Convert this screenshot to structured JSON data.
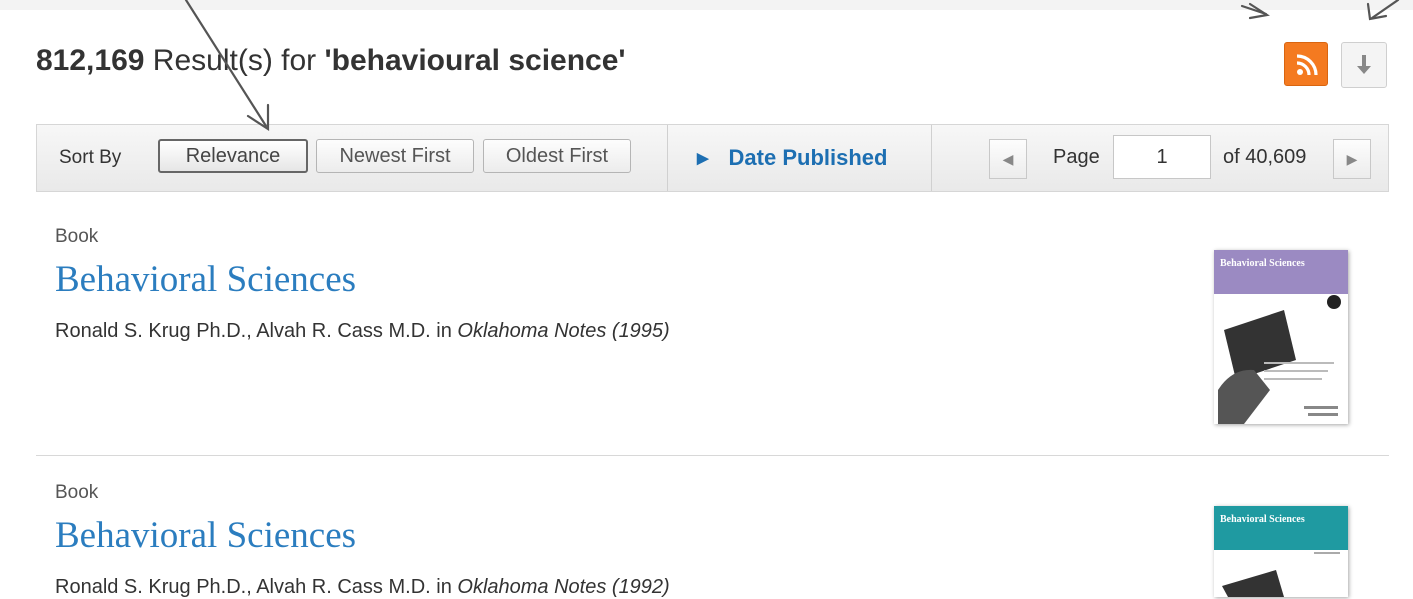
{
  "results_header": {
    "count": "812,169",
    "mid_text": " Result(s) for ",
    "query": "'behavioural science'"
  },
  "actions": {
    "rss_icon": "rss-icon",
    "download_icon": "download-arrow-icon",
    "rss_color": "#f47a20"
  },
  "toolbar": {
    "sort_by_label": "Sort By",
    "sort_options": [
      "Relevance",
      "Newest First",
      "Oldest First"
    ],
    "active_sort": "Relevance",
    "date_filter_label": "Date Published",
    "page_label": "Page",
    "page_value": "1",
    "page_total": "of 40,609",
    "link_color": "#1d6fb2"
  },
  "results": [
    {
      "type": "Book",
      "title": "Behavioral Sciences",
      "authors": "Ronald S. Krug Ph.D., Alvah R. Cass M.D. in ",
      "source": "Oklahoma Notes (1995)",
      "cover_title": "Behavioral Sciences",
      "cover_band_color": "#9b8ac2",
      "cover_series": "Oklahoma Notes",
      "cover_authors": "Ronald S. Krug\nAlvah R. Cass"
    },
    {
      "type": "Book",
      "title": "Behavioral Sciences",
      "authors": "Ronald S. Krug Ph.D., Alvah R. Cass M.D. in ",
      "source": "Oklahoma Notes (1992)",
      "cover_title": "Behavioral Sciences",
      "cover_band_color": "#1f9aa1",
      "cover_series": "Oklahoma Notes"
    }
  ]
}
